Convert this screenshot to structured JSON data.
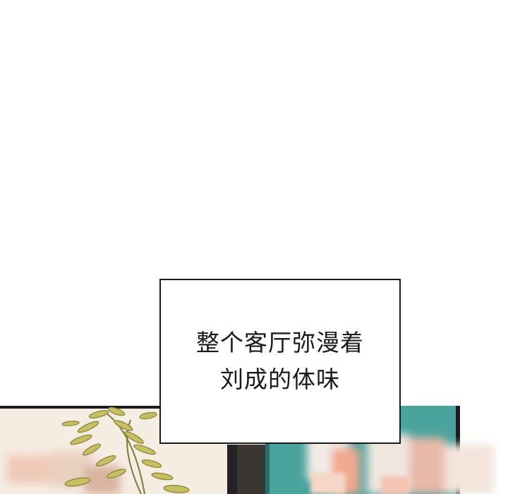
{
  "caption": {
    "lines": [
      "整个客厅弥漫着",
      "刘成的体味"
    ]
  },
  "colors": {
    "background": "#ffffff",
    "ink": "#1a1a1a",
    "wall_cream": "#f4ebe0",
    "fern": "#b9b35a",
    "teal_panel": "#4fa8a3",
    "dark_frame": "#1c1c1c",
    "blur_pink": "#f1dcd2"
  }
}
